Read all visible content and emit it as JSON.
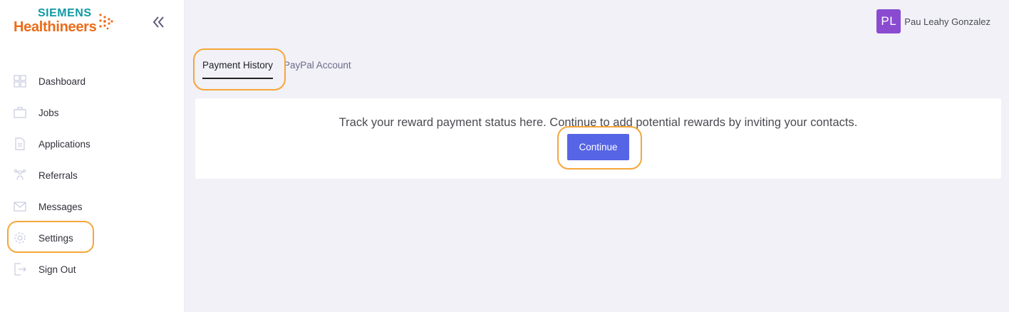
{
  "logo": {
    "line1": "SIEMENS",
    "line2": "Healthineers",
    "colors": {
      "teal": "#0f9aa5",
      "orange": "#ec6b18"
    }
  },
  "sidebar": {
    "collapse_icon": "double-chevron-left-icon",
    "items": [
      {
        "label": "Dashboard",
        "icon": "dashboard-grid-icon"
      },
      {
        "label": "Jobs",
        "icon": "briefcase-icon"
      },
      {
        "label": "Applications",
        "icon": "document-icon"
      },
      {
        "label": "Referrals",
        "icon": "referral-network-icon"
      },
      {
        "label": "Messages",
        "icon": "envelope-icon"
      },
      {
        "label": "Settings",
        "icon": "gear-icon"
      },
      {
        "label": "Sign Out",
        "icon": "sign-out-icon"
      }
    ]
  },
  "header": {
    "avatar_initials": "PL",
    "user_name": "Pau Leahy Gonzalez",
    "avatar_color": "#8a4bd1"
  },
  "tabs": [
    {
      "label": "Payment History",
      "active": true
    },
    {
      "label": "PayPal Account",
      "active": false
    }
  ],
  "card": {
    "message": "Track your reward payment status here. Continue to add potential rewards by inviting your contacts.",
    "button_label": "Continue",
    "button_color": "#5664e6"
  },
  "highlight_color": "#f5a63a"
}
